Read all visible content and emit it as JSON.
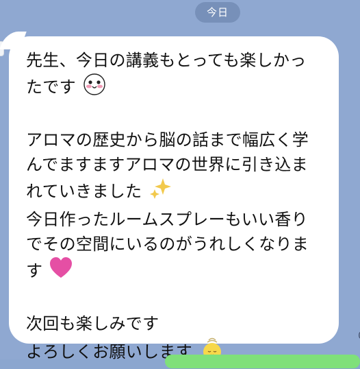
{
  "chat": {
    "date_label": "今日",
    "time_partial": "0",
    "lines": [
      "先生、今日の講義もとっても楽しかっ",
      "たです",
      "",
      "アロマの歴史から脳の話まで幅広く学",
      "んでますますアロマの世界に引き込ま",
      "れていきました",
      "今日作ったルームスプレーもいい香り",
      "でその空間にいるのがうれしくなりま",
      "す",
      "",
      "次回も楽しみです",
      "よろしくお願いします"
    ]
  },
  "icons": {
    "face": "blushing-face-icon",
    "sparkles": "sparkles-icon",
    "heart": "pink-heart-icon",
    "chick": "chick-face-icon"
  },
  "colors": {
    "background": "#8fa8d1",
    "bubble": "#ffffff",
    "date_pill": "#647ca5",
    "heart": "#e54fa4",
    "sparkles": "#f2c94c",
    "chick": "#f7d84a",
    "outgoing": "#7fe07a"
  }
}
